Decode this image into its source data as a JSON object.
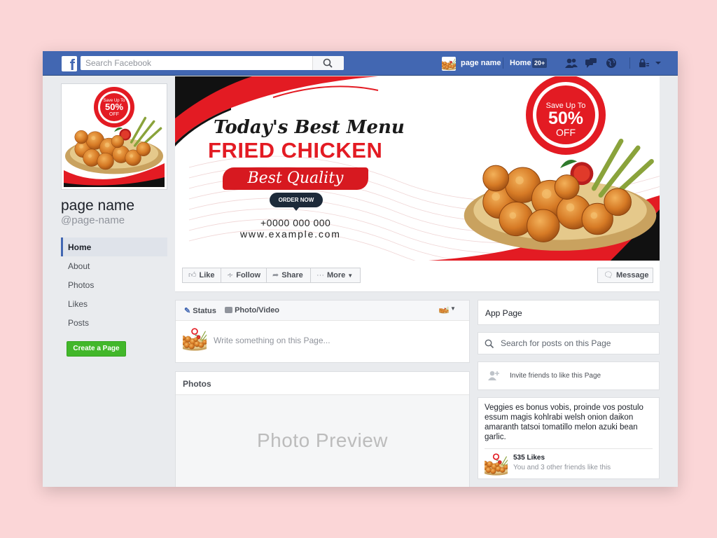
{
  "topbar": {
    "logo": "f",
    "search_placeholder": "Search Facebook",
    "page_name": "page name",
    "home_label": "Home",
    "home_badge": "20+",
    "icons": [
      "search-icon",
      "friends-icon",
      "messages-icon",
      "globe-icon",
      "lock-icon",
      "chevron-down-icon"
    ]
  },
  "profile": {
    "promo_line1": "Save Up To",
    "promo_line2": "50%",
    "promo_line3": "OFF"
  },
  "page": {
    "name": "page name",
    "handle": "@page-name"
  },
  "nav": [
    {
      "label": "Home",
      "active": true
    },
    {
      "label": "About"
    },
    {
      "label": "Photos"
    },
    {
      "label": "Likes"
    },
    {
      "label": "Posts"
    }
  ],
  "create_page_label": "Create a Page",
  "cover": {
    "tagline": "Today's Best Menu",
    "headline": "FRIED CHICKEN",
    "quality": "Best Quality",
    "order": "ORDER NOW",
    "phone": "+0000 000 000",
    "url": "www.example.com",
    "promo_line1": "Save Up To",
    "promo_line2": "50%",
    "promo_line3": "OFF",
    "colors": {
      "accent_red": "#e31b23",
      "dark": "#111111"
    }
  },
  "actions": {
    "like": "Like",
    "follow": "Follow",
    "share": "Share",
    "more": "More",
    "message": "Message"
  },
  "composer": {
    "status_tab": "Status",
    "photo_tab": "Photo/Video",
    "placeholder": "Write something on this Page..."
  },
  "photos": {
    "title": "Photos",
    "preview": "Photo Preview"
  },
  "sidebar_right": {
    "app_page": "App Page",
    "search_placeholder": "Search for posts on this Page",
    "invite": "Invite friends to like this Page",
    "about": "Veggies es bonus vobis, proinde vos postulo essum magis kohlrabi welsh onion daikon amaranth tatsoi tomatillo melon azuki bean garlic.",
    "likes": "535 Likes",
    "friends_like": "You and 3 other friends like this"
  },
  "brand_colors": {
    "facebook_blue": "#4267b2",
    "create_green": "#42b72a",
    "background_pink": "#fbd6d7"
  }
}
